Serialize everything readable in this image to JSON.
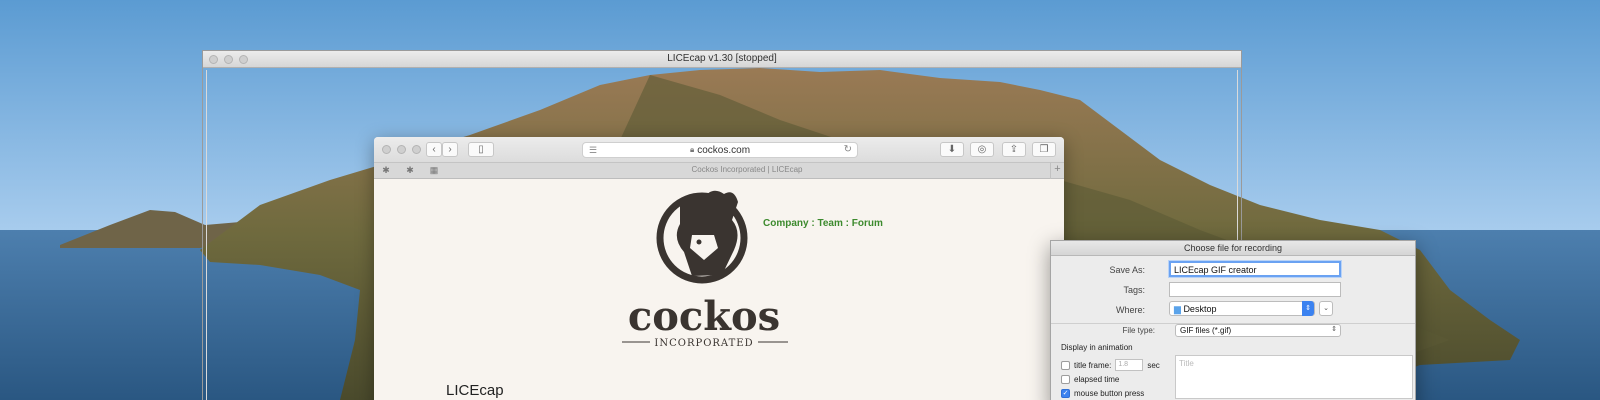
{
  "desktop": {
    "wallpaper": "mountain island landscape",
    "sky_color": "#6fa8d9",
    "sea_color": "#2f5f8a"
  },
  "licecap": {
    "title": "LICEcap v1.30 [stopped]"
  },
  "browser": {
    "url": "cockos.com",
    "tab_title": "Cockos Incorporated | LICEcap",
    "page": {
      "logo_text": "cockos",
      "logo_subtext": "INCORPORATED",
      "nav": {
        "company": "Company",
        "team": "Team",
        "forum": "Forum",
        "sep": " : "
      },
      "heading": "LICEcap"
    }
  },
  "dialog": {
    "title": "Choose file for recording",
    "save_as_label": "Save As:",
    "save_as_value": "LICEcap GIF creator",
    "tags_label": "Tags:",
    "tags_value": "",
    "where_label": "Where:",
    "where_value": "Desktop",
    "file_type_label": "File type:",
    "file_type_value": "GIF files (*.gif)",
    "display_section": "Display in animation",
    "title_frame_label": "title frame:",
    "title_frame_value": "1.8",
    "title_frame_unit": "sec",
    "elapsed_time_label": "elapsed time",
    "mouse_button_label": "mouse button press",
    "title_placeholder": "Title"
  },
  "colors": {
    "accent": "#3b82f0",
    "nav_green": "#3d8a2e",
    "page_bg": "#f8f4ef"
  }
}
